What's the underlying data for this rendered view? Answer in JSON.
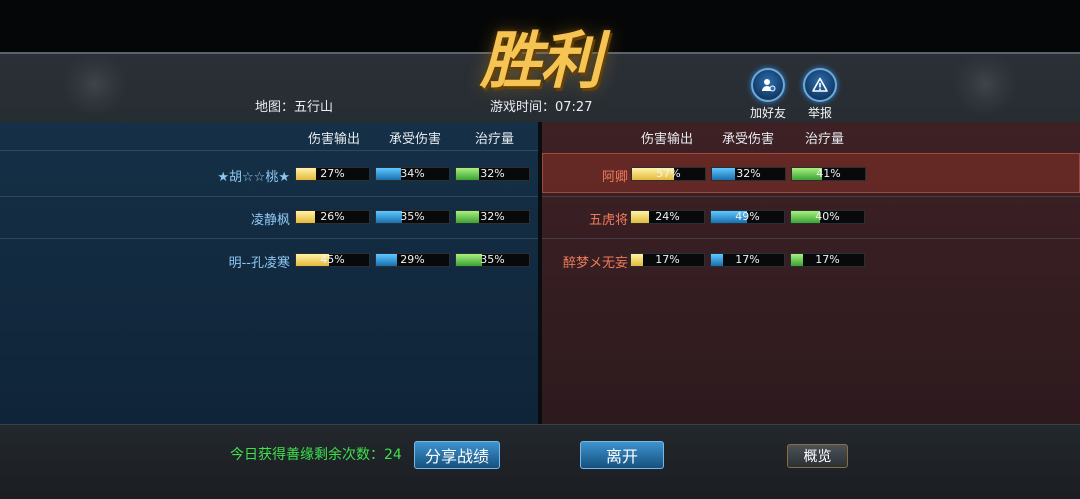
{
  "title": "胜利",
  "header": {
    "map_label": "地图：五行山",
    "time_label": "游戏时间：07:27",
    "add_friend_label": "加好友",
    "report_label": "举报",
    "add_friend_icon": "add-friend-icon",
    "report_icon": "warning-icon"
  },
  "columns": [
    "伤害输出",
    "承受伤害",
    "治疗量"
  ],
  "left_team": [
    {
      "name": "★胡☆☆桃★",
      "damage": 27,
      "taken": 34,
      "heal": 32,
      "damage_label": "27%",
      "taken_label": "34%",
      "heal_label": "32%"
    },
    {
      "name": "凌静枫",
      "damage": 26,
      "taken": 35,
      "heal": 32,
      "damage_label": "26%",
      "taken_label": "35%",
      "heal_label": "32%"
    },
    {
      "name": "明--孔凌寒",
      "damage": 45,
      "taken": 29,
      "heal": 35,
      "damage_label": "45%",
      "taken_label": "29%",
      "heal_label": "35%"
    }
  ],
  "right_team": [
    {
      "name": "阿卿",
      "damage": 57,
      "taken": 32,
      "heal": 41,
      "damage_label": "57%",
      "taken_label": "32%",
      "heal_label": "41%",
      "highlighted": true
    },
    {
      "name": "五虎将",
      "damage": 24,
      "taken": 49,
      "heal": 40,
      "damage_label": "24%",
      "taken_label": "49%",
      "heal_label": "40%"
    },
    {
      "name": "醉梦メ无妄",
      "damage": 17,
      "taken": 17,
      "heal": 17,
      "damage_label": "17%",
      "taken_label": "17%",
      "heal_label": "17%"
    }
  ],
  "footer": {
    "remaining_label": "今日获得善缘剩余次数：24",
    "share_label": "分享战绩",
    "leave_label": "离开",
    "overview_label": "概览"
  },
  "colors": {
    "title_gold": "#f6c452",
    "damage_bar": "#e4b93a",
    "taken_bar": "#1a6fae",
    "heal_bar": "#3ba234",
    "left_panel": "#153047",
    "right_panel": "#3e2125",
    "remaining_text": "#3ee04c"
  }
}
